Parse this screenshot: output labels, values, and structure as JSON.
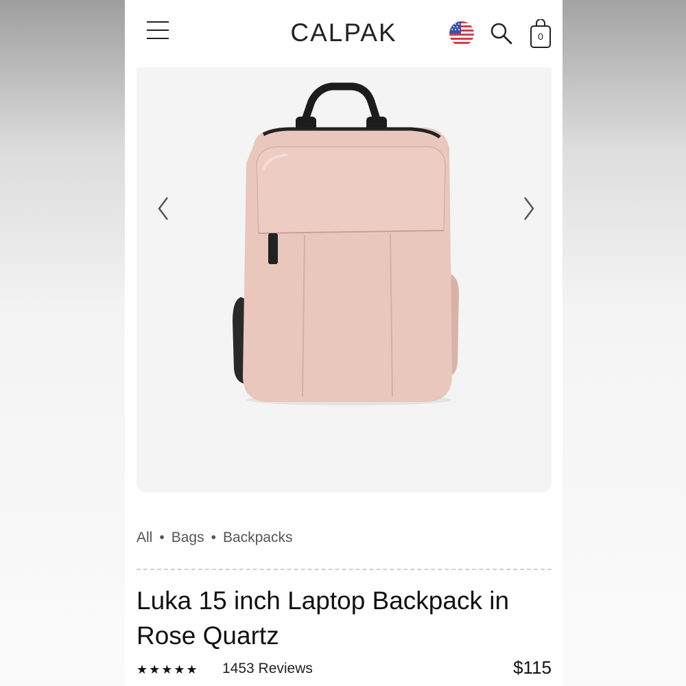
{
  "header": {
    "logo": "CALPAK",
    "menu_icon": "hamburger-menu-icon",
    "flag_icon": "us-flag-icon",
    "search_icon": "search-icon",
    "cart_icon": "shopping-bag-icon",
    "cart_count": "0"
  },
  "gallery": {
    "prev_icon": "chevron-left-icon",
    "next_icon": "chevron-right-icon",
    "background_color": "#f4f4f4",
    "product_color": "#e9c7bd"
  },
  "breadcrumb": {
    "items": [
      "All",
      "Bags",
      "Backpacks"
    ],
    "separator": "•"
  },
  "product": {
    "title": "Luka 15 inch Laptop Backpack in Rose Quartz",
    "rating": 4.5,
    "stars": "★★★★★",
    "reviews": "1453 Reviews",
    "price": "$115"
  }
}
